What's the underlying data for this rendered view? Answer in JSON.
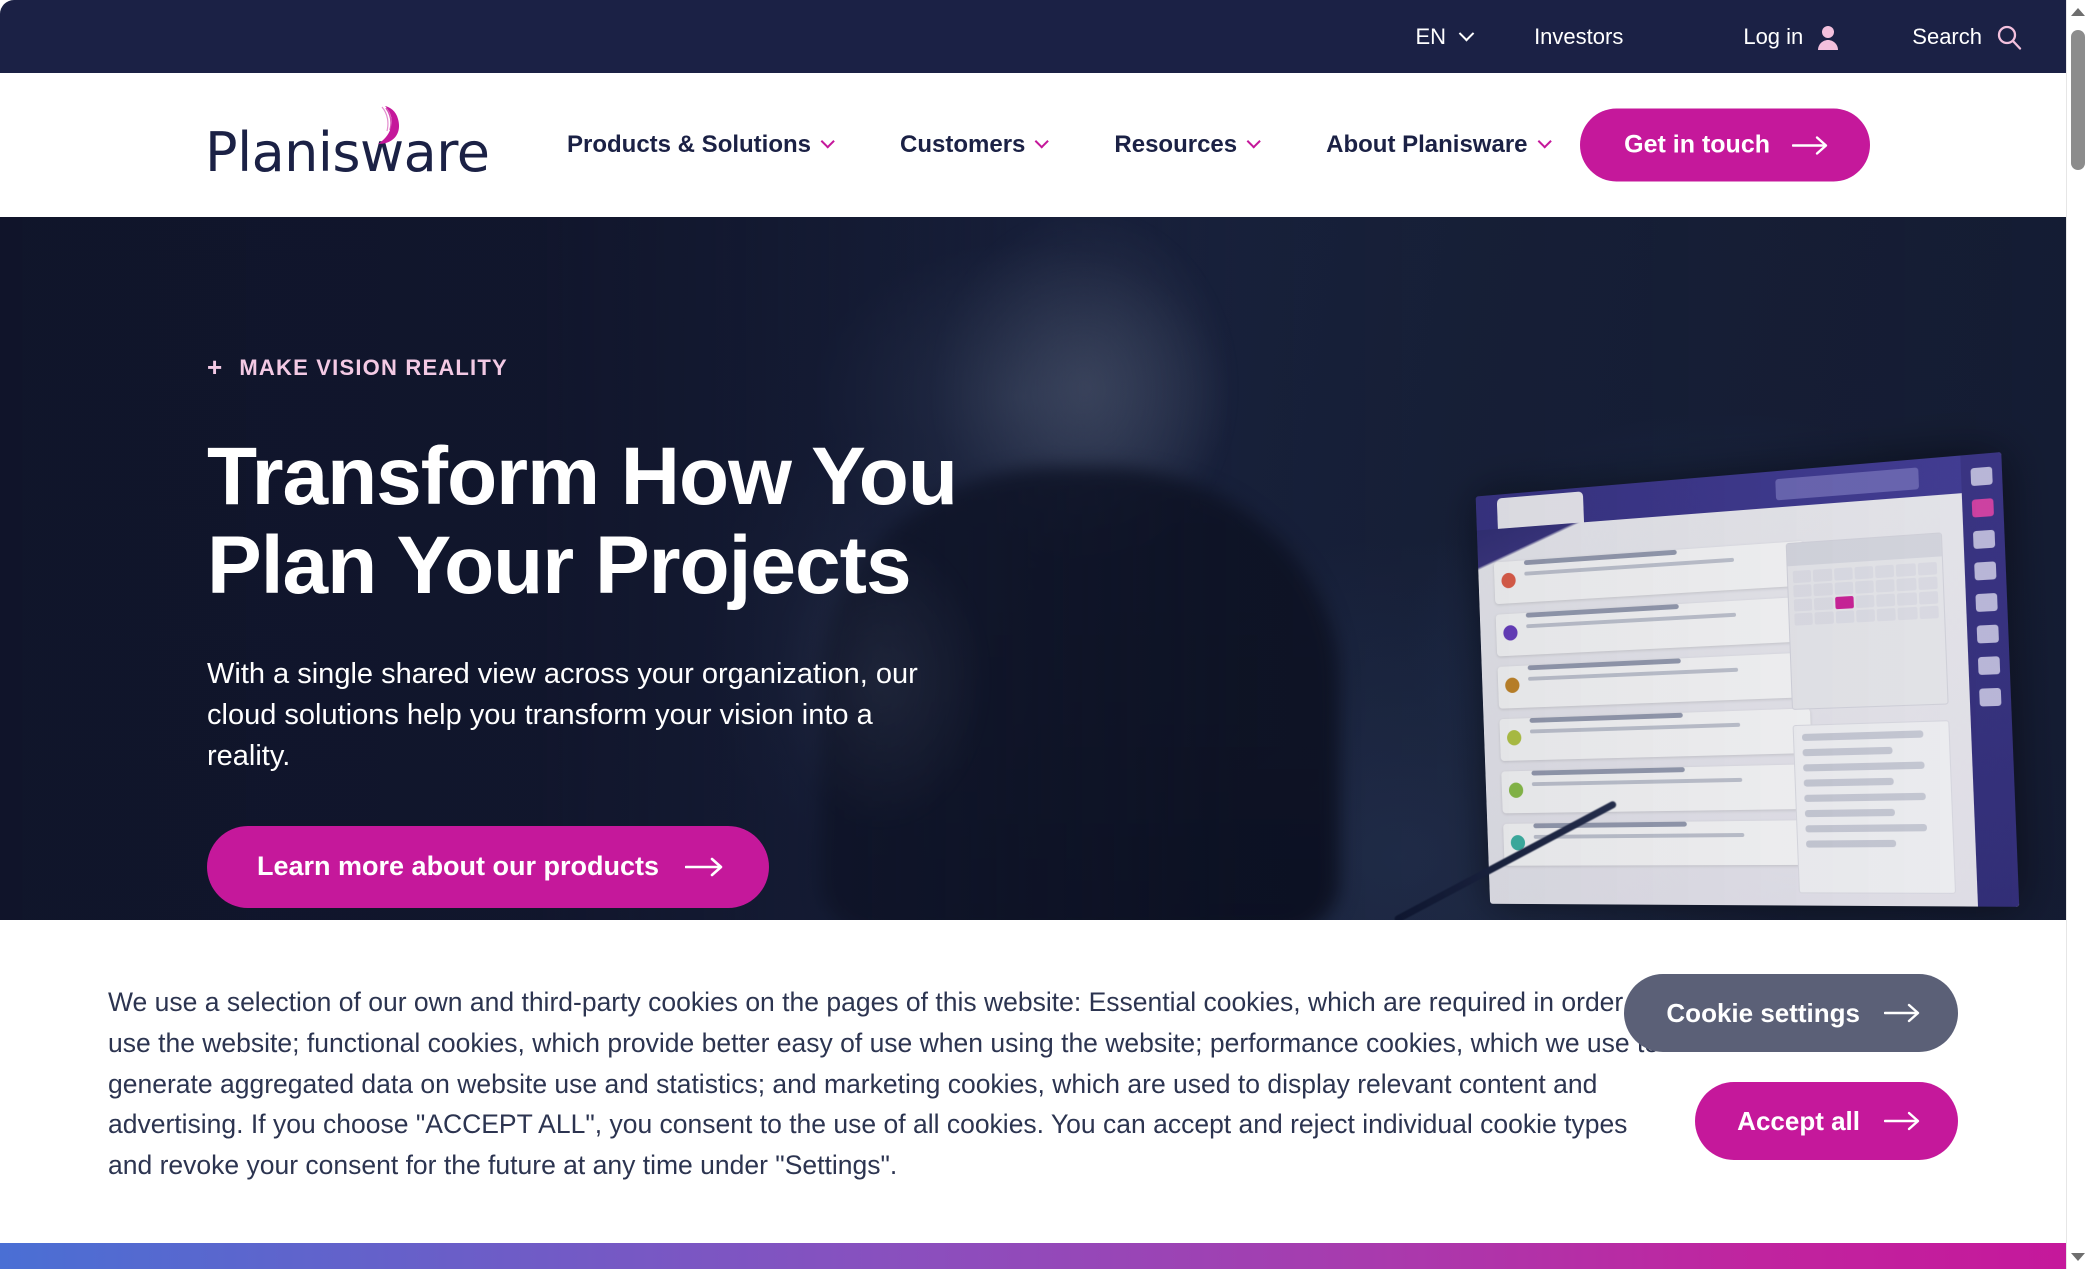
{
  "topbar": {
    "language": "EN",
    "language_chevron_icon": "chevron-down-icon",
    "investors_label": "Investors",
    "login_label": "Log in",
    "login_icon": "person-icon",
    "search_label": "Search",
    "search_icon": "search-icon",
    "background_color": "#1b2145"
  },
  "nav": {
    "logo_text": "Planisware",
    "logo_swoosh_icon": "crescent-swoosh-icon",
    "items": [
      {
        "label": "Products & Solutions",
        "chevron_icon": "chevron-down-icon"
      },
      {
        "label": "Customers",
        "chevron_icon": "chevron-down-icon"
      },
      {
        "label": "Resources",
        "chevron_icon": "chevron-down-icon"
      },
      {
        "label": "About Planisware",
        "chevron_icon": "chevron-down-icon"
      }
    ],
    "cta_label": "Get in touch",
    "cta_arrow_icon": "arrow-right-icon",
    "cta_color": "#c5189b"
  },
  "hero": {
    "eyebrow_plus": "+",
    "eyebrow": "MAKE VISION REALITY",
    "title_line1": "Transform How You",
    "title_line2": "Plan Your Projects",
    "subtitle": "With a single shared view across your organization, our cloud solutions help you transform your vision into a reality.",
    "cta_label": "Learn more about our products",
    "cta_arrow_icon": "arrow-right-icon",
    "background_color": "#141a33"
  },
  "cookie_banner": {
    "body": "We use a selection of our own and third-party cookies on the pages of this website: Essential cookies, which are required in order to use the website; functional cookies, which provide better easy of use when using the website; performance cookies, which we use to generate aggregated data on website use and statistics; and marketing cookies, which are used to display relevant content and advertising. If you choose \"ACCEPT ALL\", you consent to the use of all cookies. You can accept and reject individual cookie types and revoke your consent for the future at any time under \"Settings\".",
    "settings_label": "Cookie settings",
    "settings_arrow_icon": "arrow-right-icon",
    "settings_color": "#5b6077",
    "accept_label": "Accept all",
    "accept_arrow_icon": "arrow-right-icon",
    "accept_color": "#c5189b"
  },
  "bottom_strip": {
    "gradient_from": "#4a6fd4",
    "gradient_to": "#c5189b"
  },
  "scrollbar": {
    "up_icon": "caret-up-icon",
    "down_icon": "caret-down-icon",
    "thumb": "scrollbar-thumb"
  }
}
